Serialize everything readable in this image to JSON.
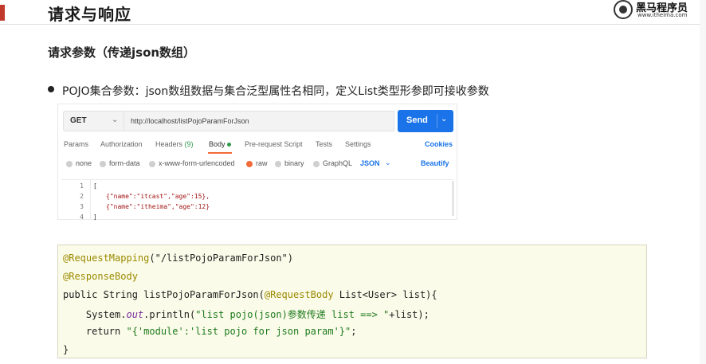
{
  "header": {
    "title": "请求与响应",
    "logo_brand": "黑马程序员",
    "logo_url": "www.itheima.com"
  },
  "subtitle": "请求参数（传递json数组）",
  "bullet": "POJO集合参数：json数组数据与集合泛型属性名相同，定义List类型形参即可接收参数",
  "postman": {
    "method": "GET",
    "url": "http://localhost/listPojoParamForJson",
    "send_label": "Send",
    "tabs": [
      "Params",
      "Authorization",
      "Headers",
      "Body",
      "Pre-request Script",
      "Tests",
      "Settings"
    ],
    "headers_count": "(9)",
    "cookies_label": "Cookies",
    "body_types": [
      "none",
      "form-data",
      "x-www-form-urlencoded",
      "raw",
      "binary",
      "GraphQL"
    ],
    "format": "JSON",
    "beautify_label": "Beautify",
    "editor": {
      "line_numbers": [
        "1",
        "2",
        "3",
        "4"
      ],
      "lines": [
        "[",
        "{\"name\":\"itcast\",\"age\":15},",
        "{\"name\":\"itheima\",\"age\":12}",
        "]"
      ]
    }
  },
  "code": {
    "line1_ann": "@RequestMapping",
    "line1_rest": "(\"/listPojoParamForJson\")",
    "line2": "@ResponseBody",
    "line3_a": "public String listPojoParamForJson(",
    "line3_ann": "@RequestBody",
    "line3_b": " List<User> list){",
    "line4_a": "    System.",
    "line4_out": "out",
    "line4_b": ".println(",
    "line4_str": "\"list pojo(json)参数传递 list ==> \"",
    "line4_c": "+list);",
    "line5_a": "    return ",
    "line5_str": "\"{'module':'list pojo for json param'}\"",
    "line5_b": ";",
    "line6": "}"
  },
  "colors": {
    "accent": "#c0392b",
    "send_blue": "#1a73e8",
    "orange": "#f26b3a",
    "code_bg": "#fbfbe9"
  }
}
